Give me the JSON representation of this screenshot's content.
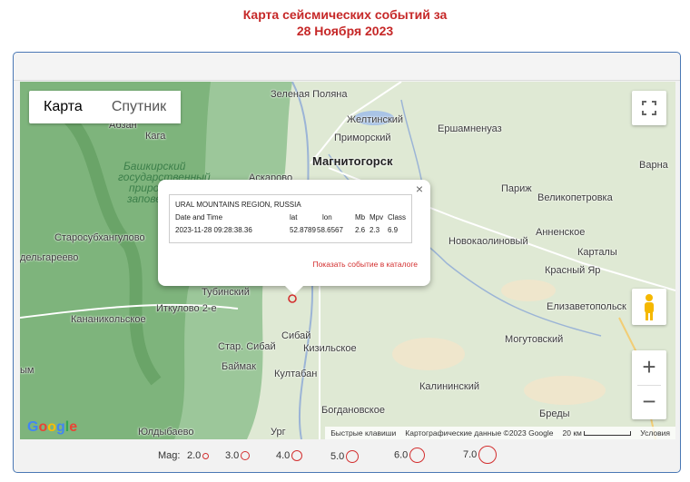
{
  "title": {
    "line1": "Карта сейсмических событий за",
    "line2": "28 Ноября 2023"
  },
  "map": {
    "map_type": {
      "map": "Карта",
      "satellite": "Спутник",
      "selected": "map"
    },
    "places": [
      "Зеленая Поляна",
      "Желтинский",
      "Приморский",
      "Ершамненуаз",
      "Магнитогорск",
      "Варна",
      "Аскарово",
      "Кага",
      "Абзан",
      "Башкирский",
      "государственный",
      "природный",
      "заповедник",
      "Париж",
      "Великопетровка",
      "Старосубхангулово",
      "Новокаолиновый",
      "Анненское",
      "Карталы",
      "дельгареево",
      "Красный Яр",
      "Тубинский",
      "Иткулово 2-е",
      "Кананикольское",
      "Елизаветопольск",
      "Сибай",
      "Стар. Сибай",
      "Кизильское",
      "Могутовский",
      "Баймак",
      "Култабан",
      "Калининский",
      "Богдановское",
      "Бреды",
      "Юлдыбаево",
      "Ург",
      "ым"
    ],
    "controls": {
      "zoom_in": "+",
      "zoom_out": "−",
      "fullscreen_icon": "fullscreen-icon",
      "pegman_icon": "pegman-icon"
    },
    "attribution": {
      "shortcuts": "Быстрые клавиши",
      "map_data": "Картографические данные ©2023 Google",
      "scale": "20 км",
      "terms": "Условия",
      "logo": "Google"
    },
    "marker_color": "#d32f2f"
  },
  "popup": {
    "region": "URAL MOUNTAINS REGION, RUSSIA",
    "headers": {
      "datetime": "Date and Time",
      "lat": "lat",
      "lon": "lon",
      "mb": "Mb",
      "mpv": "Mpv",
      "class": "Class"
    },
    "values": {
      "datetime": "2023-11-28 09:28:38.36",
      "lat": "52.8789",
      "lon": "58.6567",
      "mb": "2.6",
      "mpv": "2.3",
      "class": "6.9"
    },
    "link": "Показать событие в каталоге",
    "close": "×"
  },
  "legend": {
    "label": "Mag:",
    "items": [
      {
        "value": "2.0"
      },
      {
        "value": "3.0"
      },
      {
        "value": "4.0"
      },
      {
        "value": "5.0"
      },
      {
        "value": "6.0"
      },
      {
        "value": "7.0"
      }
    ]
  }
}
